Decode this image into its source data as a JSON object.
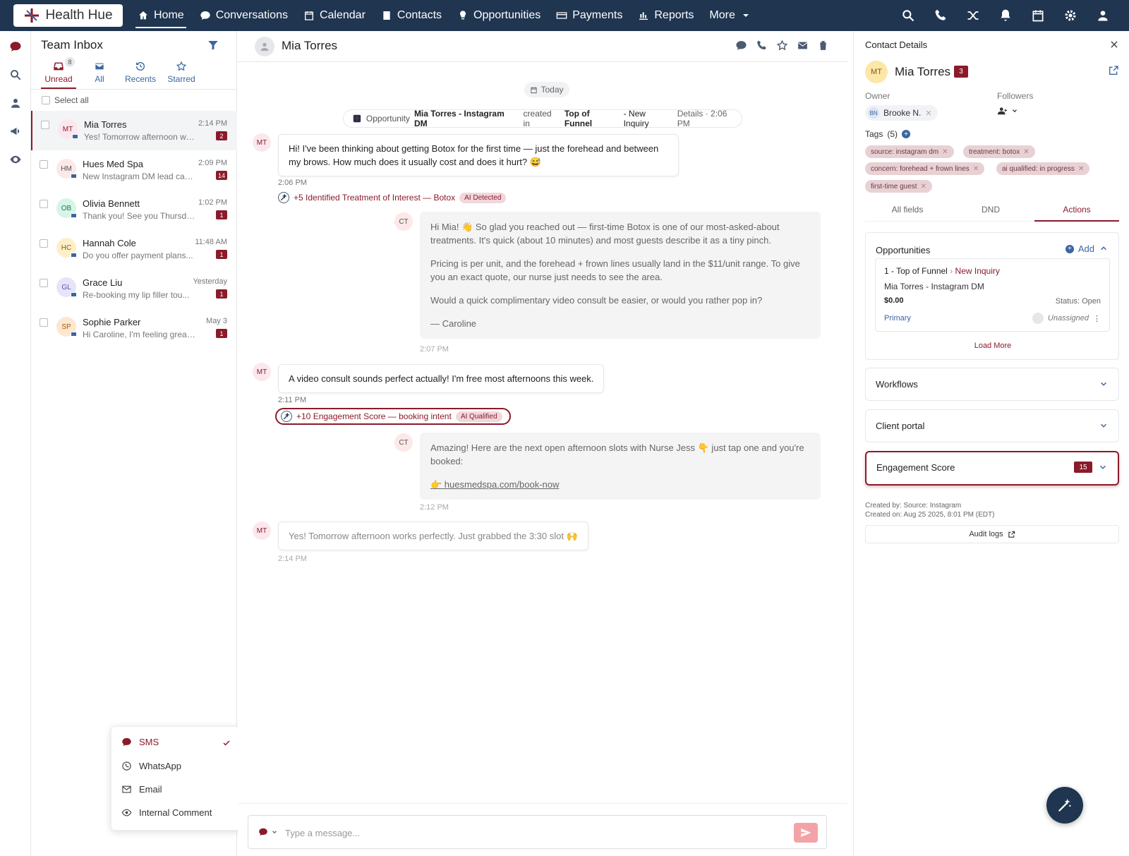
{
  "app": {
    "name": "Health Hue"
  },
  "nav": {
    "items": [
      {
        "label": "Home",
        "icon": "home-icon"
      },
      {
        "label": "Conversations",
        "icon": "chat-icon"
      },
      {
        "label": "Calendar",
        "icon": "calendar-icon"
      },
      {
        "label": "Contacts",
        "icon": "contacts-icon"
      },
      {
        "label": "Opportunities",
        "icon": "lightbulb-icon"
      },
      {
        "label": "Payments",
        "icon": "payments-icon"
      },
      {
        "label": "Reports",
        "icon": "reports-icon"
      },
      {
        "label": "More",
        "icon": "chevron-down-icon"
      }
    ],
    "active": "Home"
  },
  "inbox": {
    "title": "Team Inbox",
    "tabs": [
      {
        "label": "Unread",
        "badge": "8"
      },
      {
        "label": "All"
      },
      {
        "label": "Recents"
      },
      {
        "label": "Starred"
      }
    ],
    "select_all": "Select all",
    "conversations": [
      {
        "initials": "MT",
        "name": "Mia Torres",
        "preview": "Yes! Tomorrow afternoon wo...",
        "time": "2:14 PM",
        "badge": "2",
        "color": "#fbe7ee",
        "text": "#8a1b2a"
      },
      {
        "initials": "HM",
        "name": "Hues Med Spa",
        "preview": "New Instagram DM lead capt...",
        "time": "2:09 PM",
        "badge": "14",
        "color": "#fde8e8",
        "text": "#555"
      },
      {
        "initials": "OB",
        "name": "Olivia Bennett",
        "preview": "Thank you! See you Thursday...",
        "time": "1:02 PM",
        "badge": "1",
        "color": "#d6f5e6",
        "text": "#1d7a4f"
      },
      {
        "initials": "HC",
        "name": "Hannah Cole",
        "preview": "Do you offer payment plans...",
        "time": "11:48 AM",
        "badge": "1",
        "color": "#fdf0c8",
        "text": "#7a5a10"
      },
      {
        "initials": "GL",
        "name": "Grace Liu",
        "preview": "Re-booking my lip filler tou...",
        "time": "Yesterday",
        "badge": "1",
        "color": "#e6e4f8",
        "text": "#5a4fb0"
      },
      {
        "initials": "SP",
        "name": "Sophie Parker",
        "preview": "Hi Caroline, I'm feeling great, t...",
        "time": "May 3",
        "badge": "1",
        "color": "#fde7d0",
        "text": "#a05a10"
      }
    ]
  },
  "channel_menu": {
    "items": [
      {
        "label": "SMS",
        "selected": true
      },
      {
        "label": "WhatsApp"
      },
      {
        "label": "Email"
      },
      {
        "label": "Internal Comment"
      }
    ]
  },
  "conversation": {
    "contact_name": "Mia Torres",
    "date_label": "Today",
    "opp_event": {
      "prefix": "Opportunity",
      "name": "Mia Torres - Instagram DM",
      "mid": "created in",
      "stage": "Top of Funnel",
      "status": "- New Inquiry",
      "details": "Details · 2:06 PM"
    },
    "messages": [
      {
        "from": "MT",
        "text": "Hi! I've been thinking about getting Botox for the first time — just the forehead and between my brows. How much does it usually cost and does it hurt? 😅",
        "time": "2:06 PM"
      },
      {
        "from": "CT",
        "paragraphs": [
          "Hi Mia! 👋 So glad you reached out — first-time Botox is one of our most-asked-about treatments. It's quick (about 10 minutes) and most guests describe it as a tiny pinch.",
          "Pricing is per unit, and the forehead + frown lines usually land in the $11/unit range. To give you an exact quote, our nurse just needs to see the area.",
          "Would a quick complimentary video consult be easier, or would you rather pop in?",
          "— Caroline"
        ],
        "time": "2:07 PM"
      },
      {
        "from": "MT",
        "text": "A video consult sounds perfect actually! I'm free most afternoons this week.",
        "time": "2:11 PM"
      },
      {
        "from": "CT",
        "paragraphs": [
          "Amazing! Here are the next open afternoon slots with Nurse Jess 👇 just tap one and you're booked:",
          "👉 huesmedspa.com/book-now"
        ],
        "time": "2:12 PM"
      },
      {
        "from": "MT",
        "text": "Yes! Tomorrow afternoon works perfectly. Just grabbed the 3:30 slot 🙌",
        "time": "2:14 PM"
      }
    ],
    "ai_events": [
      {
        "text": "+5 Identified Treatment of Interest — Botox",
        "tag": "AI Detected"
      },
      {
        "text": "+10 Engagement Score — booking intent",
        "tag": "AI Qualified"
      }
    ],
    "composer_placeholder": "Type a message..."
  },
  "contact": {
    "panel_title": "Contact Details",
    "initials": "MT",
    "name": "Mia Torres",
    "count": "3",
    "owner_label": "Owner",
    "owner_initials": "BN",
    "owner_name": "Brooke N.",
    "followers_label": "Followers",
    "tags_label": "Tags",
    "tags_count": "(5)",
    "tags": [
      "source: instagram dm",
      "treatment: botox",
      "concern: forehead + frown lines",
      "ai qualified: in progress",
      "first-time guest"
    ],
    "tabs": [
      "All fields",
      "DND",
      "Actions"
    ],
    "active_tab": "Actions",
    "opportunities": {
      "title": "Opportunities",
      "add_label": "Add",
      "pipeline": "1 - Top of Funnel",
      "stage": "New Inquiry",
      "name": "Mia Torres - Instagram DM",
      "value": "$0.00",
      "status": "Status: Open",
      "primary": "Primary",
      "assignee": "Unassigned",
      "load_more": "Load More"
    },
    "sections": [
      "Workflows",
      "Client portal"
    ],
    "engagement": {
      "title": "Engagement Score",
      "value": "15"
    },
    "created_by": "Created by: Source: Instagram",
    "created_on": "Created on: Aug 25 2025, 8:01 PM (EDT)",
    "audit_label": "Audit logs"
  },
  "colors": {
    "brand": "#8a1b2a",
    "nav": "#1f3550",
    "link": "#3a66a0"
  }
}
